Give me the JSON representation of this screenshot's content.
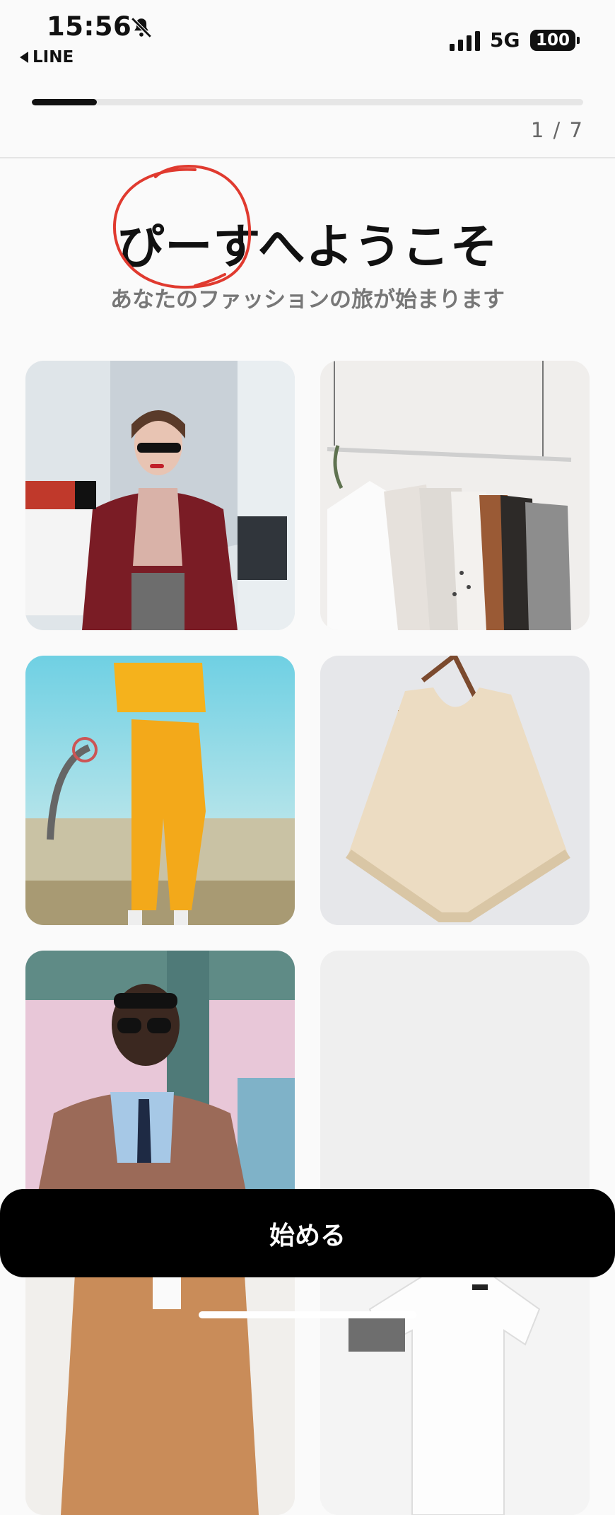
{
  "status": {
    "time": "15:56",
    "back_app": "LINE",
    "network": "5G",
    "battery": "100"
  },
  "onboarding": {
    "progress_fraction": 0.118,
    "step_label": "1 / 7",
    "title": "ぴーすへようこそ",
    "subtitle": "あなたのファッションの旅が始まります"
  },
  "gallery": [
    {
      "name": "woman-shopping-bags-photo"
    },
    {
      "name": "clothes-rack-photo"
    },
    {
      "name": "yellow-tracksuit-photo"
    },
    {
      "name": "knit-poncho-photo"
    },
    {
      "name": "man-leather-jacket-photo"
    },
    {
      "name": "empty-placeholder"
    },
    {
      "name": "camel-coat-photo"
    },
    {
      "name": "white-tshirt-photo"
    }
  ],
  "cta": {
    "label": "始める"
  },
  "colors": {
    "primary": "#000000",
    "annotation": "#e03a2f",
    "track": "#e6e6e6"
  }
}
